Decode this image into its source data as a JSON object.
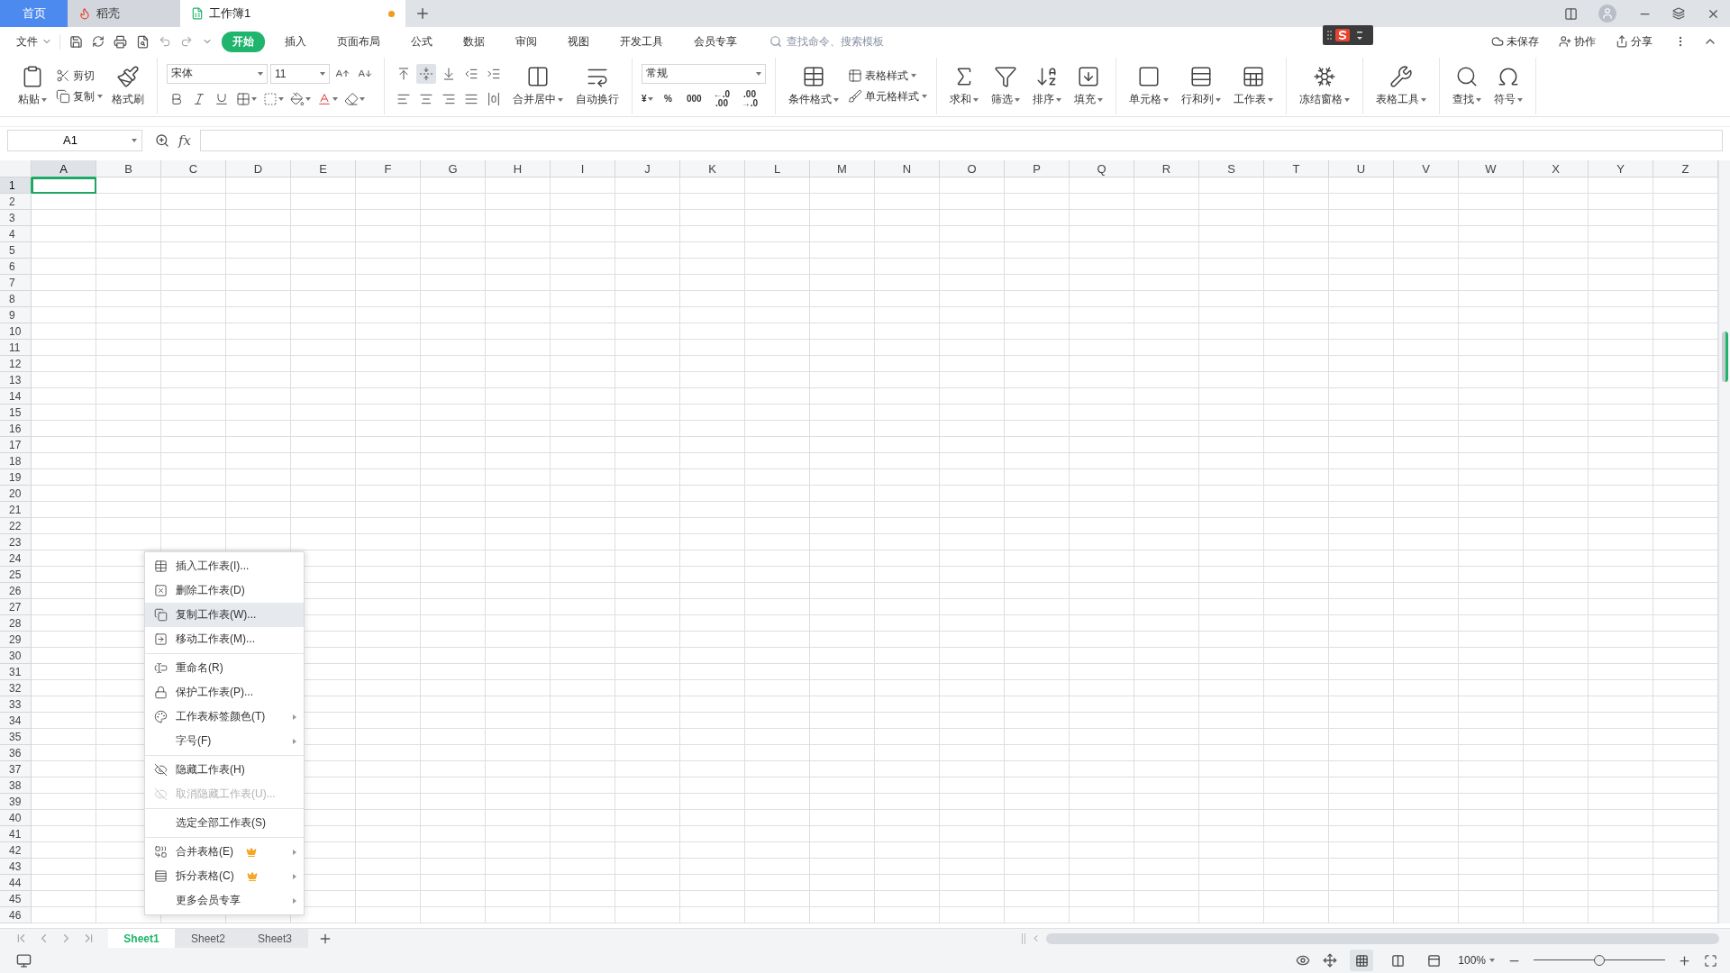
{
  "title_bar": {
    "tabs": [
      {
        "kind": "home",
        "label": "首页",
        "selected": false,
        "unsaved": false
      },
      {
        "kind": "docer",
        "label": "稻壳",
        "selected": false,
        "unsaved": false
      },
      {
        "kind": "workbook",
        "label": "工作簿1",
        "selected": true,
        "unsaved": true
      }
    ]
  },
  "menu_bar": {
    "file": "文件",
    "tabs": [
      {
        "label": "开始",
        "selected": true
      },
      {
        "label": "插入",
        "selected": false
      },
      {
        "label": "页面布局",
        "selected": false
      },
      {
        "label": "公式",
        "selected": false
      },
      {
        "label": "数据",
        "selected": false
      },
      {
        "label": "审阅",
        "selected": false
      },
      {
        "label": "视图",
        "selected": false
      },
      {
        "label": "开发工具",
        "selected": false
      },
      {
        "label": "会员专享",
        "selected": false
      }
    ],
    "search": {
      "placeholder": "查找命令、搜索模板"
    },
    "actions": [
      "未保存",
      "协作",
      "分享"
    ]
  },
  "ribbon": {
    "groups": [
      {
        "columns": [
          {
            "kind": "big",
            "label": "粘贴",
            "dropdown": true
          },
          {
            "kind": "stack",
            "rows": [
              [
                {
                  "kind": "small",
                  "label": "剪切",
                  "dropdown": false
                }
              ],
              [
                {
                  "kind": "small",
                  "label": "复制",
                  "dropdown": true
                }
              ]
            ]
          },
          {
            "kind": "big",
            "label": "格式刷",
            "dropdown": false
          }
        ]
      },
      {
        "columns": [
          {
            "kind": "stack",
            "rows": [
              [
                {
                  "kind": "combo",
                  "label": "宋体"
                },
                {
                  "kind": "combo",
                  "label": "11"
                },
                {
                  "kind": "icon",
                  "dropdown": false,
                  "selected": false
                },
                {
                  "kind": "icon",
                  "dropdown": false,
                  "selected": false
                }
              ],
              [
                {
                  "kind": "icon",
                  "dropdown": false,
                  "selected": false
                },
                {
                  "kind": "icon",
                  "dropdown": false,
                  "selected": false
                },
                {
                  "kind": "icon",
                  "dropdown": false,
                  "selected": false
                },
                {
                  "kind": "icon",
                  "dropdown": true,
                  "selected": false
                },
                {
                  "kind": "icon",
                  "dropdown": true,
                  "selected": false
                },
                {
                  "kind": "icon",
                  "dropdown": true,
                  "selected": false
                },
                {
                  "kind": "icon",
                  "dropdown": true,
                  "selected": false
                },
                {
                  "kind": "icon",
                  "dropdown": true,
                  "selected": false
                }
              ]
            ]
          }
        ]
      },
      {
        "columns": [
          {
            "kind": "stack",
            "rows": [
              [
                {
                  "kind": "icon",
                  "dropdown": false,
                  "selected": false
                },
                {
                  "kind": "icon",
                  "dropdown": false,
                  "selected": true
                },
                {
                  "kind": "icon",
                  "dropdown": false,
                  "selected": false
                },
                {
                  "kind": "icon",
                  "dropdown": false,
                  "selected": false
                },
                {
                  "kind": "icon",
                  "dropdown": false,
                  "selected": false
                }
              ],
              [
                {
                  "kind": "icon",
                  "dropdown": false,
                  "selected": false
                },
                {
                  "kind": "icon",
                  "dropdown": false,
                  "selected": false
                },
                {
                  "kind": "icon",
                  "dropdown": false,
                  "selected": false
                },
                {
                  "kind": "icon",
                  "dropdown": false,
                  "selected": false
                },
                {
                  "kind": "icon",
                  "dropdown": false,
                  "selected": false
                }
              ]
            ]
          },
          {
            "kind": "big",
            "label": "合并居中",
            "dropdown": true
          },
          {
            "kind": "big",
            "label": "自动换行",
            "dropdown": false
          }
        ]
      },
      {
        "columns": [
          {
            "kind": "stack",
            "rows": [
              [
                {
                  "kind": "combo",
                  "label": "常规"
                }
              ],
              [
                {
                  "kind": "symbol",
                  "label": "¥",
                  "dropdown": true
                },
                {
                  "kind": "symbol",
                  "label": "%",
                  "dropdown": false
                },
                {
                  "kind": "symbol",
                  "label": "000",
                  "dropdown": false
                },
                {
                  "kind": "symbol",
                  "label": "←.0 .00",
                  "dropdown": false
                },
                {
                  "kind": "symbol",
                  "label": ".00 →.0",
                  "dropdown": false
                }
              ]
            ]
          }
        ]
      },
      {
        "columns": [
          {
            "kind": "big",
            "label": "条件格式",
            "dropdown": true
          },
          {
            "kind": "stack",
            "rows": [
              [
                {
                  "kind": "small",
                  "label": "表格样式",
                  "dropdown": true
                }
              ],
              [
                {
                  "kind": "small",
                  "label": "单元格样式",
                  "dropdown": true
                }
              ]
            ]
          }
        ]
      },
      {
        "columns": [
          {
            "kind": "big",
            "label": "求和",
            "dropdown": true
          },
          {
            "kind": "big",
            "label": "筛选",
            "dropdown": true
          },
          {
            "kind": "big",
            "label": "排序",
            "dropdown": true
          },
          {
            "kind": "big",
            "label": "填充",
            "dropdown": true
          }
        ]
      },
      {
        "columns": [
          {
            "kind": "big",
            "label": "单元格",
            "dropdown": true
          },
          {
            "kind": "big",
            "label": "行和列",
            "dropdown": true
          },
          {
            "kind": "big",
            "label": "工作表",
            "dropdown": true
          }
        ]
      },
      {
        "columns": [
          {
            "kind": "big",
            "label": "冻结窗格",
            "dropdown": true
          }
        ]
      },
      {
        "columns": [
          {
            "kind": "big",
            "label": "表格工具",
            "dropdown": true
          }
        ]
      },
      {
        "columns": [
          {
            "kind": "big",
            "label": "查找",
            "dropdown": true
          },
          {
            "kind": "big",
            "label": "符号",
            "dropdown": true
          }
        ]
      }
    ]
  },
  "formula_bar": {
    "name_box": "A1",
    "fx": "fx"
  },
  "sheet": {
    "columns": [
      {
        "label": "A",
        "selected": true
      },
      {
        "label": "B",
        "selected": false
      },
      {
        "label": "C",
        "selected": false
      },
      {
        "label": "D",
        "selected": false
      },
      {
        "label": "E",
        "selected": false
      },
      {
        "label": "F",
        "selected": false
      },
      {
        "label": "G",
        "selected": false
      },
      {
        "label": "H",
        "selected": false
      },
      {
        "label": "I",
        "selected": false
      },
      {
        "label": "J",
        "selected": false
      },
      {
        "label": "K",
        "selected": false
      },
      {
        "label": "L",
        "selected": false
      },
      {
        "label": "M",
        "selected": false
      },
      {
        "label": "N",
        "selected": false
      },
      {
        "label": "O",
        "selected": false
      },
      {
        "label": "P",
        "selected": false
      },
      {
        "label": "Q",
        "selected": false
      },
      {
        "label": "R",
        "selected": false
      },
      {
        "label": "S",
        "selected": false
      },
      {
        "label": "T",
        "selected": false
      },
      {
        "label": "U",
        "selected": false
      },
      {
        "label": "V",
        "selected": false
      },
      {
        "label": "W",
        "selected": false
      },
      {
        "label": "X",
        "selected": false
      },
      {
        "label": "Y",
        "selected": false
      },
      {
        "label": "Z",
        "selected": false
      }
    ],
    "rows": [
      {
        "label": "1",
        "selected": true
      },
      {
        "label": "2",
        "selected": false
      },
      {
        "label": "3",
        "selected": false
      },
      {
        "label": "4",
        "selected": false
      },
      {
        "label": "5",
        "selected": false
      },
      {
        "label": "6",
        "selected": false
      },
      {
        "label": "7",
        "selected": false
      },
      {
        "label": "8",
        "selected": false
      },
      {
        "label": "9",
        "selected": false
      },
      {
        "label": "10",
        "selected": false
      },
      {
        "label": "11",
        "selected": false
      },
      {
        "label": "12",
        "selected": false
      },
      {
        "label": "13",
        "selected": false
      },
      {
        "label": "14",
        "selected": false
      },
      {
        "label": "15",
        "selected": false
      },
      {
        "label": "16",
        "selected": false
      },
      {
        "label": "17",
        "selected": false
      },
      {
        "label": "18",
        "selected": false
      },
      {
        "label": "19",
        "selected": false
      },
      {
        "label": "20",
        "selected": false
      },
      {
        "label": "21",
        "selected": false
      },
      {
        "label": "22",
        "selected": false
      },
      {
        "label": "23",
        "selected": false
      },
      {
        "label": "24",
        "selected": false
      },
      {
        "label": "25",
        "selected": false
      },
      {
        "label": "26",
        "selected": false
      },
      {
        "label": "27",
        "selected": false
      },
      {
        "label": "28",
        "selected": false
      },
      {
        "label": "29",
        "selected": false
      },
      {
        "label": "30",
        "selected": false
      },
      {
        "label": "31",
        "selected": false
      },
      {
        "label": "32",
        "selected": false
      },
      {
        "label": "33",
        "selected": false
      },
      {
        "label": "34",
        "selected": false
      },
      {
        "label": "35",
        "selected": false
      },
      {
        "label": "36",
        "selected": false
      },
      {
        "label": "37",
        "selected": false
      },
      {
        "label": "38",
        "selected": false
      },
      {
        "label": "39",
        "selected": false
      },
      {
        "label": "40",
        "selected": false
      },
      {
        "label": "41",
        "selected": false
      },
      {
        "label": "42",
        "selected": false
      },
      {
        "label": "43",
        "selected": false
      },
      {
        "label": "44",
        "selected": false
      },
      {
        "label": "45",
        "selected": false
      },
      {
        "label": "46",
        "selected": false
      }
    ]
  },
  "context_menu": {
    "groups": [
      [
        {
          "label": "插入工作表(I)...",
          "highlighted": false,
          "disabled": false,
          "submenu": false,
          "crown": false
        },
        {
          "label": "删除工作表(D)",
          "highlighted": false,
          "disabled": false,
          "submenu": false,
          "crown": false
        },
        {
          "label": "复制工作表(W)...",
          "highlighted": true,
          "disabled": false,
          "submenu": false,
          "crown": false
        },
        {
          "label": "移动工作表(M)...",
          "highlighted": false,
          "disabled": false,
          "submenu": false,
          "crown": false
        }
      ],
      [
        {
          "label": "重命名(R)",
          "highlighted": false,
          "disabled": false,
          "submenu": false,
          "crown": false
        },
        {
          "label": "保护工作表(P)...",
          "highlighted": false,
          "disabled": false,
          "submenu": false,
          "crown": false
        },
        {
          "label": "工作表标签颜色(T)",
          "highlighted": false,
          "disabled": false,
          "submenu": true,
          "crown": false
        },
        {
          "label": "字号(F)",
          "highlighted": false,
          "disabled": false,
          "submenu": true,
          "crown": false
        }
      ],
      [
        {
          "label": "隐藏工作表(H)",
          "highlighted": false,
          "disabled": false,
          "submenu": false,
          "crown": false
        },
        {
          "label": "取消隐藏工作表(U)...",
          "highlighted": false,
          "disabled": true,
          "submenu": false,
          "crown": false
        }
      ],
      [
        {
          "label": "选定全部工作表(S)",
          "highlighted": false,
          "disabled": false,
          "submenu": false,
          "crown": false
        }
      ],
      [
        {
          "label": "合并表格(E)",
          "highlighted": false,
          "disabled": false,
          "submenu": true,
          "crown": true
        },
        {
          "label": "拆分表格(C)",
          "highlighted": false,
          "disabled": false,
          "submenu": true,
          "crown": true
        },
        {
          "label": "更多会员专享",
          "highlighted": false,
          "disabled": false,
          "submenu": true,
          "crown": false
        }
      ]
    ]
  },
  "sheet_tabs": [
    {
      "label": "Sheet1",
      "selected": true
    },
    {
      "label": "Sheet2",
      "selected": false
    },
    {
      "label": "Sheet3",
      "selected": false
    }
  ],
  "status_bar": {
    "views": [
      {
        "kind": "normal",
        "selected": true
      },
      {
        "kind": "page-break",
        "selected": false
      },
      {
        "kind": "reading",
        "selected": false
      }
    ],
    "zoom": "100%",
    "zoom_slider": {
      "level": 0.5
    }
  }
}
